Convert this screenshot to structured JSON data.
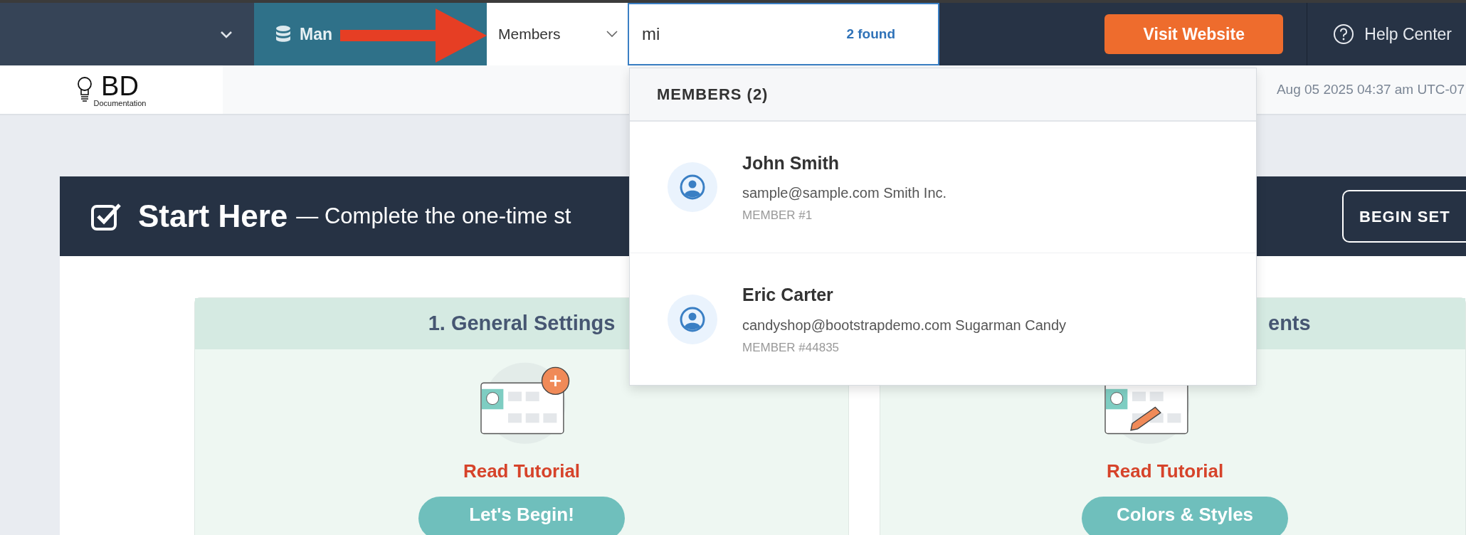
{
  "topbar": {
    "section_tab": {
      "label": "Man"
    },
    "search_scope": {
      "value": "Members"
    },
    "search": {
      "value": "mi",
      "count": "2 found"
    },
    "visit_button": "Visit Website",
    "help_link": "Help Center"
  },
  "logo": {
    "mark": "BD",
    "caption": "Documentation"
  },
  "timestamp": "Aug 05 2025 04:37 am UTC-07",
  "start_panel": {
    "title": "Start Here",
    "subtitle": "— Complete the one-time st",
    "button": "BEGIN SET"
  },
  "cards": [
    {
      "kind": "add",
      "title": "1. General Settings",
      "link": "Read Tutorial",
      "button": "Let's Begin!"
    },
    {
      "kind": "edit",
      "title": "ents",
      "link": "Read Tutorial",
      "button": "Colors & Styles"
    }
  ],
  "results": {
    "heading": "MEMBERS (2)",
    "items": [
      {
        "name": "John Smith",
        "details": "sample@sample.com Smith Inc.",
        "id": "MEMBER #1"
      },
      {
        "name": "Eric Carter",
        "details": "candyshop@bootstrapdemo.com Sugarman Candy",
        "id": "MEMBER #44835"
      }
    ]
  }
}
